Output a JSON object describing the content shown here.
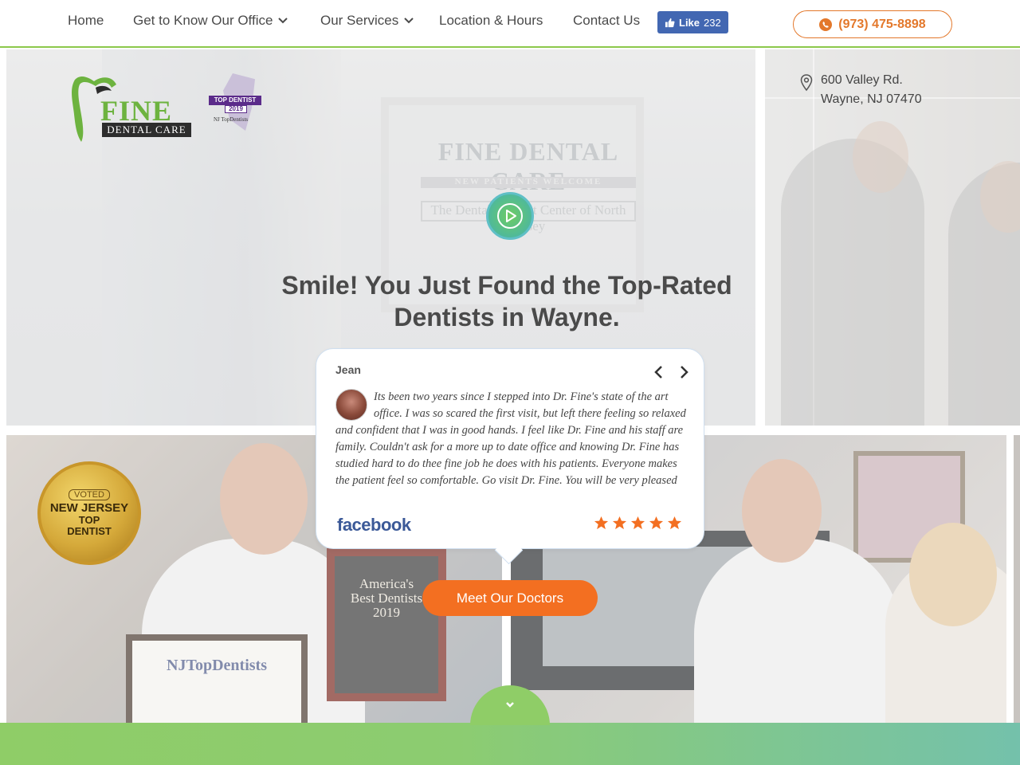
{
  "nav": {
    "items": [
      {
        "label": "Home"
      },
      {
        "label": "Get to Know Our Office"
      },
      {
        "label": "Our Services"
      },
      {
        "label": "Location & Hours"
      },
      {
        "label": "Contact Us"
      }
    ],
    "fb_like": {
      "label": "Like",
      "count": "232"
    },
    "phone": "(973) 475-8898"
  },
  "logo": {
    "brand": "FINE",
    "sub": "DENTAL CARE"
  },
  "top_badge": {
    "ribbon": "TOP DENTIST",
    "year": "2019",
    "source": "NJ TopDentists"
  },
  "address": {
    "line1": "600 Valley Rd.",
    "line2": "Wayne, NJ 07470"
  },
  "hero": {
    "sign_title": "FINE DENTAL CARE",
    "sign_subtitle": "NEW PATIENTS WELCOME",
    "sign_tagline": "The Dental Implant Center of North Jersey",
    "headline_line1": "Smile! You Just Found the Top-Rated",
    "headline_line2": "Dentists in Wayne."
  },
  "seal": {
    "voted": "VOTED",
    "line1": "NEW JERSEY",
    "line2": "TOP",
    "line3": "DENTIST"
  },
  "photos": {
    "certificate": "NJTopDentists",
    "plaque_line1": "America's",
    "plaque_line2": "Best Dentists",
    "plaque_year": "2019"
  },
  "review": {
    "name": "Jean",
    "text": "Its been two years since I stepped into Dr. Fine's state of the art office. I was so scared the first visit, but left there feeling so relaxed and confident that I was in good hands. I feel like Dr. Fine and his staff are family. Couldn't ask for a more up to date office and knowing Dr. Fine has studied hard to do thee fine job he does with his patients. Everyone makes the patient feel so comfortable. Go visit Dr. Fine. You will be very pleased",
    "source": "facebook",
    "rating": 5,
    "star_color": "#f36f21"
  },
  "cta": {
    "meet_doctors": "Meet Our Doctors"
  },
  "colors": {
    "accent_green": "#8cc84b",
    "accent_orange": "#f36f21",
    "facebook_blue": "#3b5998"
  }
}
